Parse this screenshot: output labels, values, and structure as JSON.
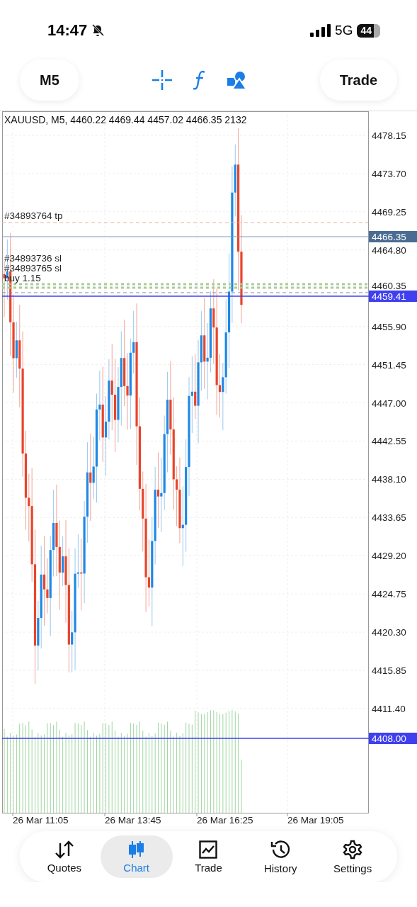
{
  "status_bar": {
    "time": "14:47",
    "network": "5G",
    "battery": "44"
  },
  "toolbar": {
    "timeframe": "M5",
    "action": "Trade"
  },
  "chart": {
    "header": "XAUUSD, M5, 4460.22 4469.44 4457.02 4466.35 2132",
    "price_labels": [
      "4478.15",
      "4473.70",
      "4469.25",
      "4464.80",
      "4460.35",
      "4455.90",
      "4451.45",
      "4447.00",
      "4442.55",
      "4438.10",
      "4433.65",
      "4429.20",
      "4424.75",
      "4420.30",
      "4415.85",
      "4411.40"
    ],
    "price_tags": [
      {
        "kind": "bid",
        "label": "4466.35"
      },
      {
        "kind": "ask",
        "label": "4459.41"
      },
      {
        "kind": "level",
        "label": "4408.00"
      }
    ],
    "order_labels": [
      "#34893764 tp",
      "#34893736 sl",
      "#34893765 sl",
      "buy 1.15"
    ],
    "time_labels": [
      "26 Mar 11:05",
      "26 Mar 13:45",
      "26 Mar 16:25",
      "26 Mar 19:05"
    ]
  },
  "nav": [
    {
      "label": "Quotes",
      "selected": false
    },
    {
      "label": "Chart",
      "selected": true
    },
    {
      "label": "Trade",
      "selected": false
    },
    {
      "label": "History",
      "selected": false
    },
    {
      "label": "Settings",
      "selected": false
    }
  ]
}
